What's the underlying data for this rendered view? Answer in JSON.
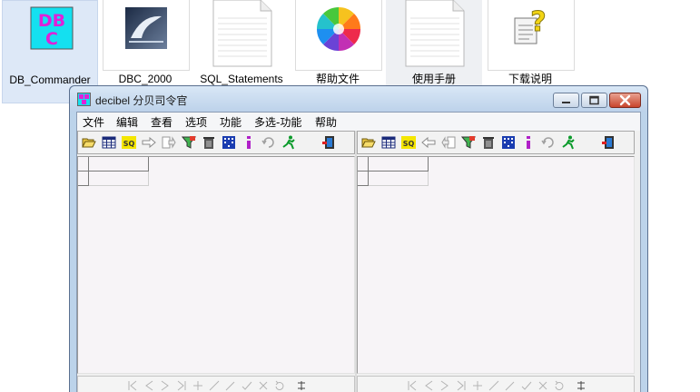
{
  "desktop": {
    "icons": [
      {
        "label": "DB_Commander",
        "art_text_top": "DB",
        "art_text_bottom": "C"
      },
      {
        "label": "DBC_2000"
      },
      {
        "label": "SQL_Statements"
      },
      {
        "label": "帮助文件"
      },
      {
        "label": "使用手册"
      },
      {
        "label": "下载说明"
      }
    ]
  },
  "window": {
    "title": "decibel 分贝司令官",
    "menu": [
      "文件",
      "编辑",
      "查看",
      "选项",
      "功能",
      "多选-功能",
      "帮助"
    ]
  },
  "colors": {
    "selection": "#dde8f7",
    "titlebar": "#bdd2ea",
    "grid_background": "#f7f4f7"
  }
}
